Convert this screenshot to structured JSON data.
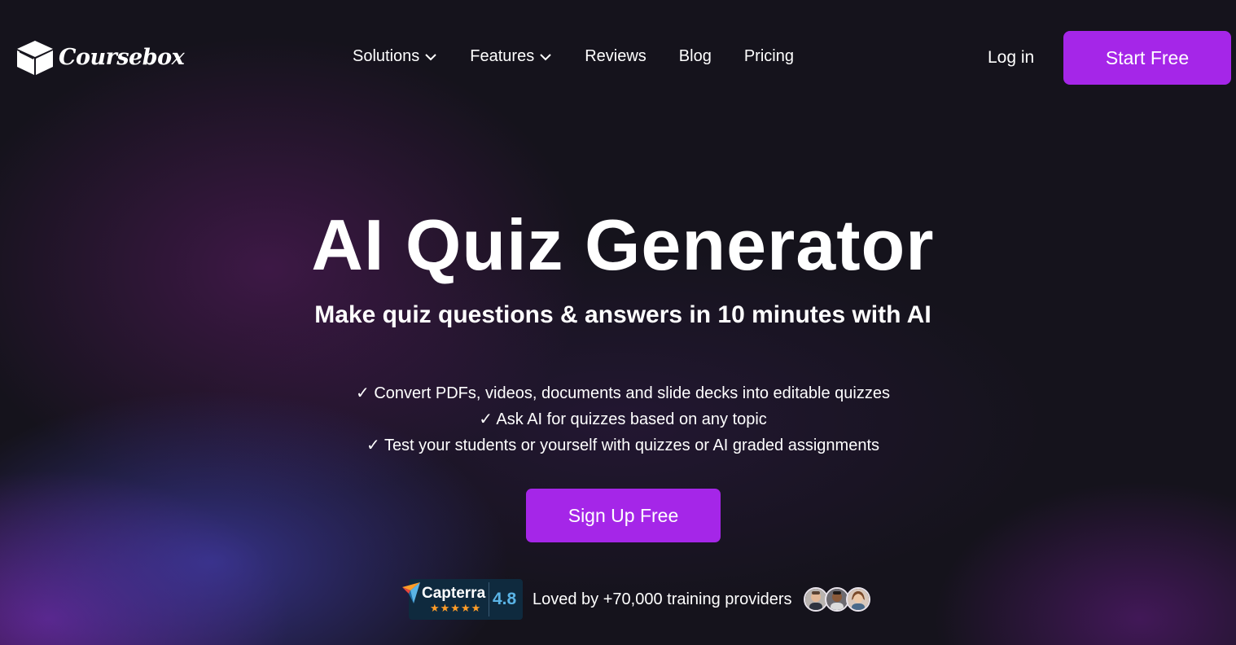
{
  "brand": {
    "name": "Coursebox",
    "logo_icon": "box-icon"
  },
  "nav": {
    "items": [
      {
        "label": "Solutions",
        "dropdown": true
      },
      {
        "label": "Features",
        "dropdown": true
      },
      {
        "label": "Reviews",
        "dropdown": false
      },
      {
        "label": "Blog",
        "dropdown": false
      },
      {
        "label": "Pricing",
        "dropdown": false
      }
    ],
    "login_label": "Log in",
    "start_label": "Start Free"
  },
  "hero": {
    "title": "AI Quiz Generator",
    "subtitle": "Make quiz questions & answers in 10 minutes with AI",
    "features": [
      "✓ Convert PDFs, videos, documents and slide decks into editable quizzes",
      "✓ Ask AI for quizzes based on any topic",
      "✓ Test your students or yourself with quizzes or AI graded assignments"
    ],
    "cta_label": "Sign Up Free"
  },
  "social_proof": {
    "capterra_name": "Capterra",
    "capterra_stars": "★★★★★",
    "capterra_rating": "4.8",
    "loved_text": "Loved by +70,000 training providers",
    "avatar_count": 3
  },
  "colors": {
    "accent": "#a526e8",
    "background": "#15131c",
    "capterra_bg": "#0f2a3e",
    "capterra_score": "#5ab4e6",
    "star": "#ff9d28"
  }
}
